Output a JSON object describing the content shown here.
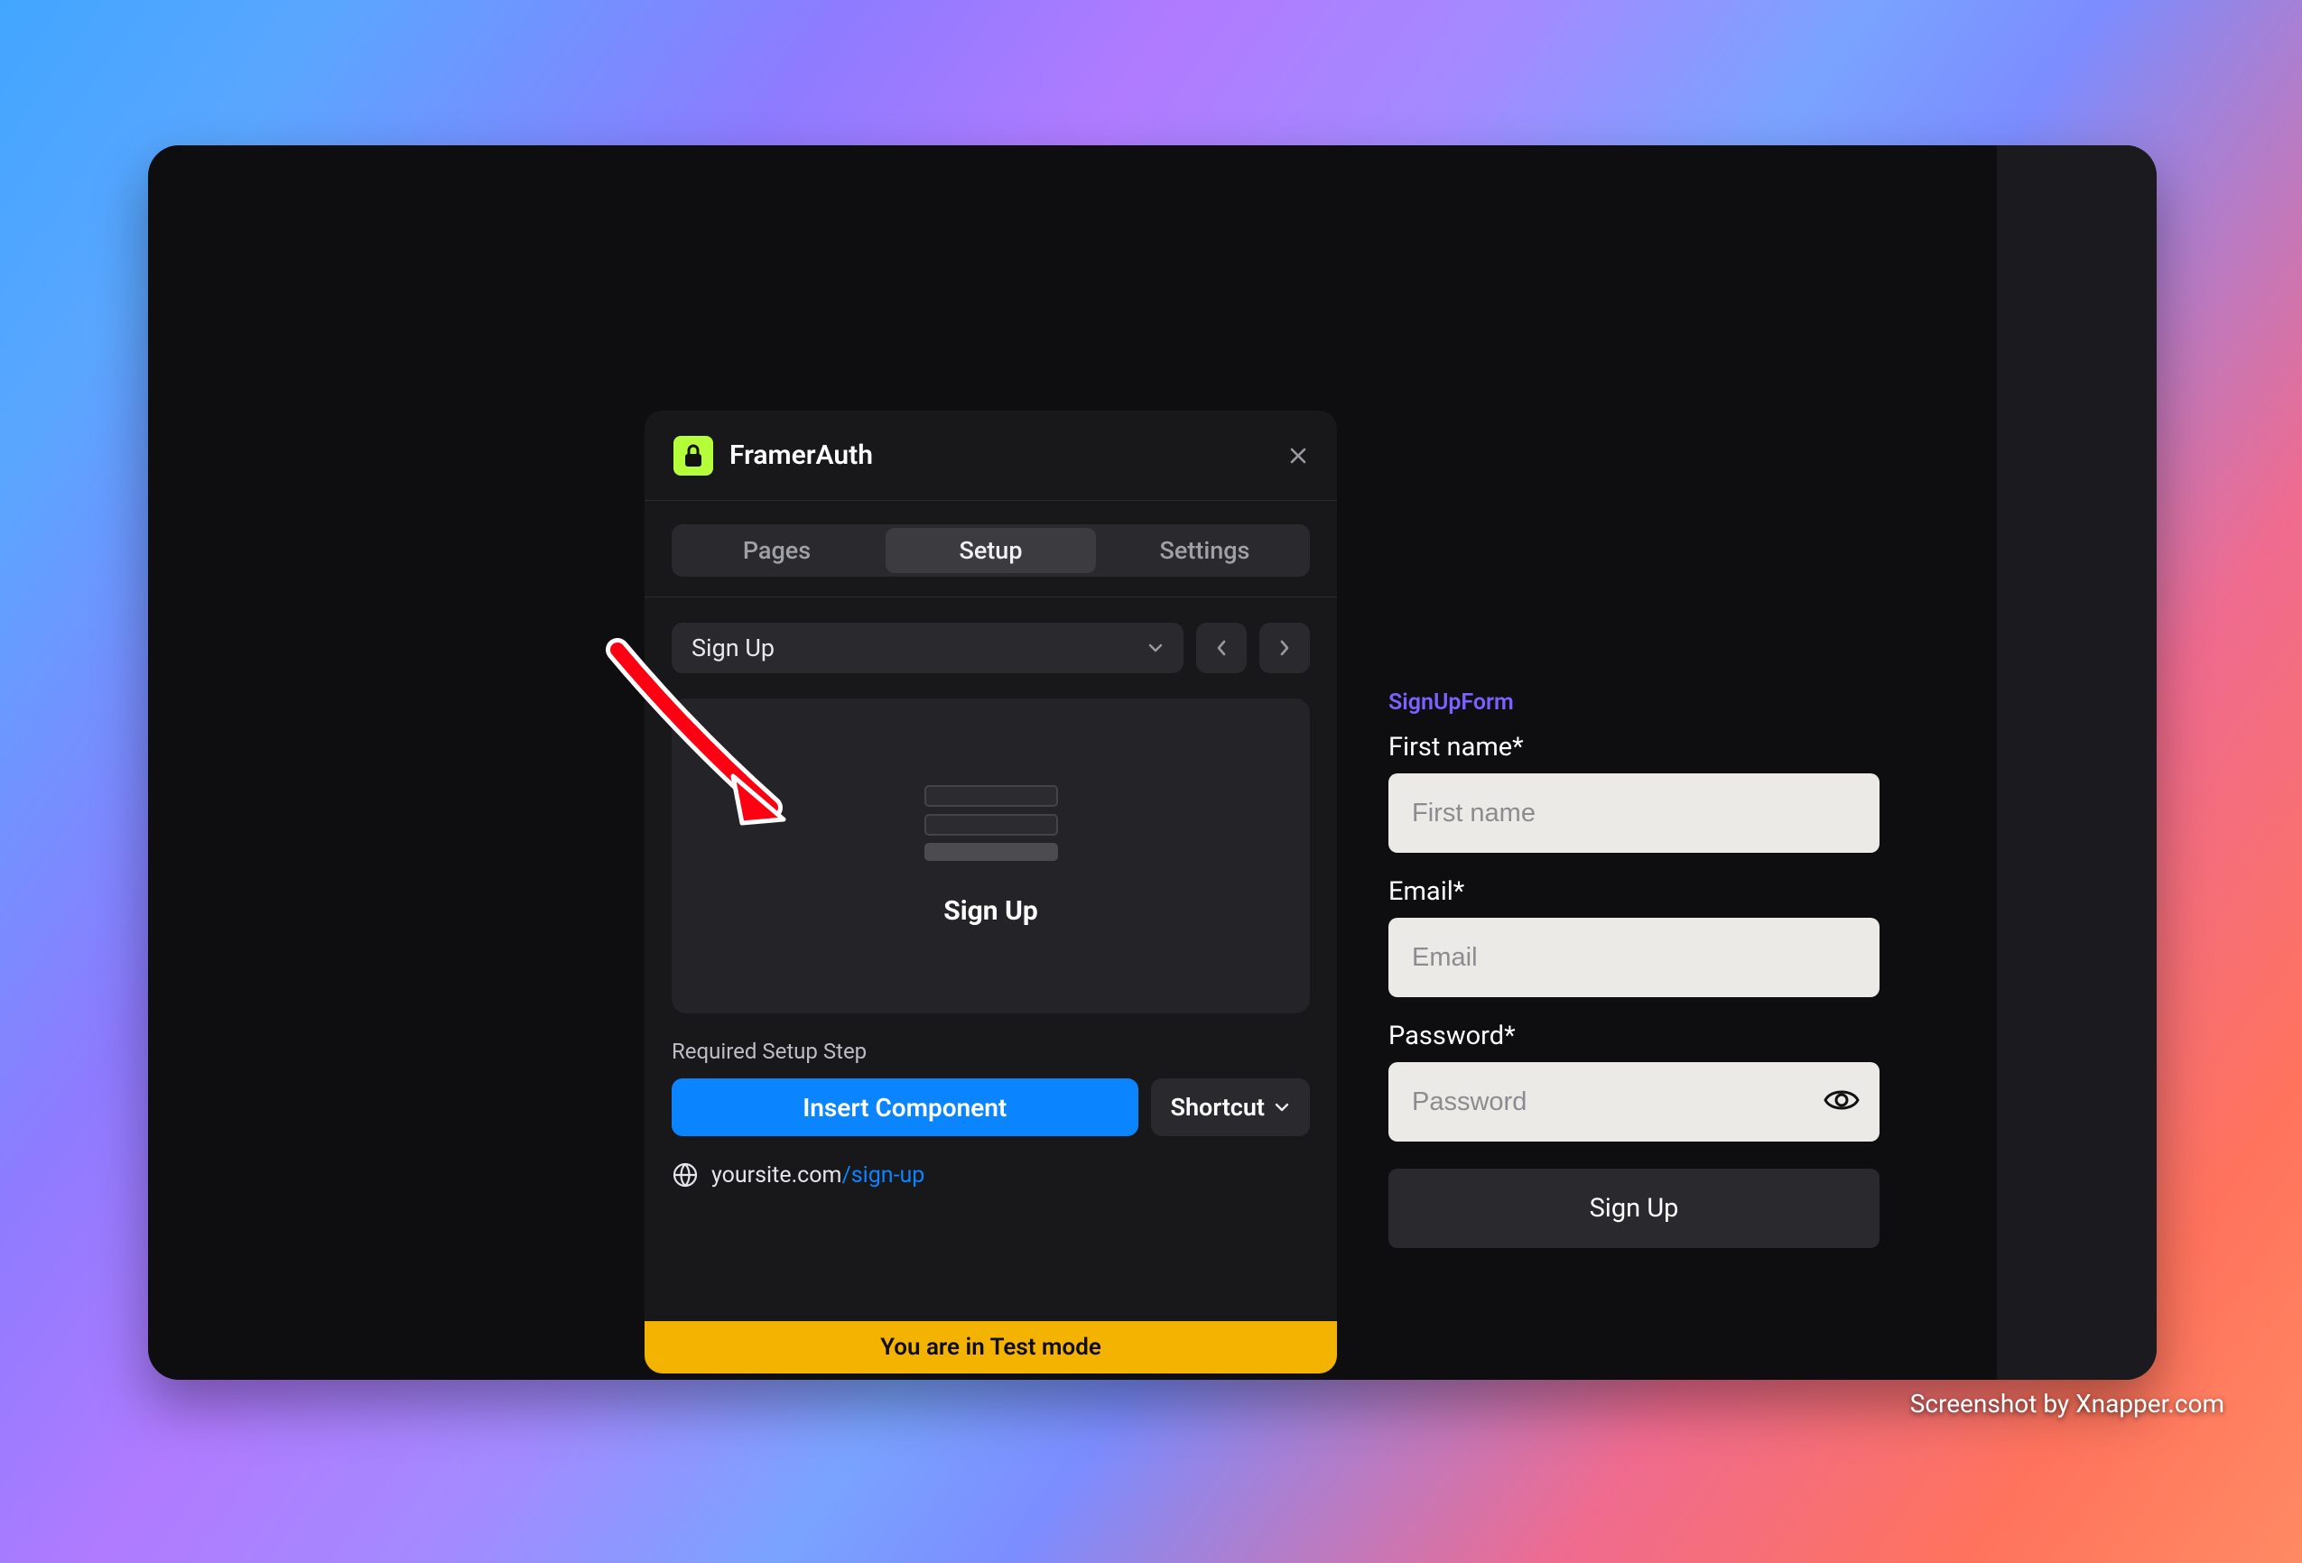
{
  "panel": {
    "title": "FramerAuth",
    "tabs": [
      "Pages",
      "Setup",
      "Settings"
    ],
    "active_tab": "Setup",
    "select": {
      "value": "Sign Up"
    },
    "preview_title": "Sign Up",
    "required_label": "Required Setup Step",
    "insert_button": "Insert Component",
    "shortcut_button": "Shortcut",
    "url_base": "yoursite.com",
    "url_slug": "/sign-up",
    "banner": "You are in Test mode"
  },
  "form": {
    "badge": "SignUpForm",
    "first_name_label": "First name*",
    "first_name_placeholder": "First name",
    "email_label": "Email*",
    "email_placeholder": "Email",
    "password_label": "Password*",
    "password_placeholder": "Password",
    "submit": "Sign Up"
  },
  "credit": "Screenshot by Xnapper.com"
}
